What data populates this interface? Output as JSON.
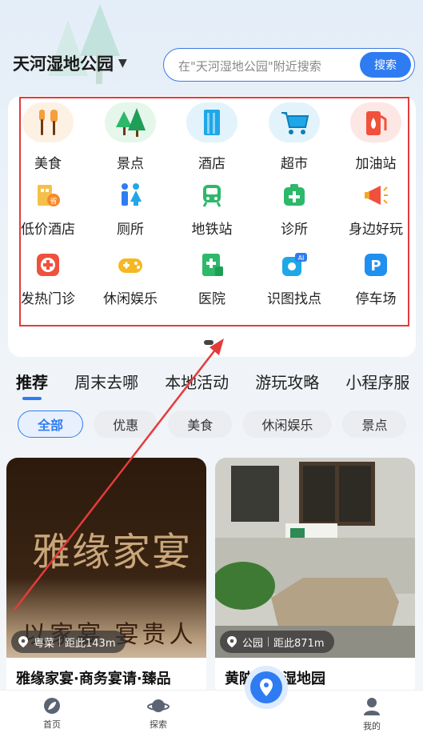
{
  "header": {
    "location": "天河湿地公园",
    "search_placeholder": "在\"天河湿地公园\"附近搜索",
    "search_button": "搜索"
  },
  "categories": [
    {
      "label": "美食",
      "icon": "food-icon",
      "color": "#f59e3b"
    },
    {
      "label": "景点",
      "icon": "trees-icon",
      "color": "#2db86a"
    },
    {
      "label": "酒店",
      "icon": "hotel-icon",
      "color": "#1fa7e8"
    },
    {
      "label": "超市",
      "icon": "cart-icon",
      "color": "#1fa7e8"
    },
    {
      "label": "加油站",
      "icon": "gas-station-icon",
      "color": "#f0503c"
    },
    {
      "label": "低价酒店",
      "icon": "budget-hotel-icon",
      "color": "#f5a623"
    },
    {
      "label": "厕所",
      "icon": "toilet-icon",
      "color": "#2f7cf2"
    },
    {
      "label": "地铁站",
      "icon": "subway-icon",
      "color": "#2db86a"
    },
    {
      "label": "诊所",
      "icon": "clinic-icon",
      "color": "#2db86a"
    },
    {
      "label": "身边好玩",
      "icon": "megaphone-icon",
      "color": "#f5a623"
    },
    {
      "label": "发热门诊",
      "icon": "fever-clinic-icon",
      "color": "#f0503c"
    },
    {
      "label": "休闲娱乐",
      "icon": "gamepad-icon",
      "color": "#f5b823"
    },
    {
      "label": "医院",
      "icon": "hospital-icon",
      "color": "#2db86a"
    },
    {
      "label": "识图找点",
      "icon": "ai-image-search-icon",
      "color": "#1fa7e8"
    },
    {
      "label": "停车场",
      "icon": "parking-icon",
      "color": "#1f8ff0"
    }
  ],
  "tabs": [
    "推荐",
    "周末去哪",
    "本地活动",
    "游玩攻略",
    "小程序服"
  ],
  "chips": [
    "全部",
    "优惠",
    "美食",
    "休闲娱乐",
    "景点"
  ],
  "cards": [
    {
      "image_text": "雅缘家宴",
      "image_slogan": "以家宴 宴贵人",
      "category": "粤菜",
      "distance": "距此143m",
      "title": "雅缘家宴·商务宴请·臻品"
    },
    {
      "category": "公园",
      "distance": "距此871m",
      "title": "黄陂生态湿地园"
    }
  ],
  "bottom_nav": [
    {
      "label": "首页",
      "icon": "home-leaf-icon"
    },
    {
      "label": "探索",
      "icon": "planet-icon"
    },
    {
      "label": "",
      "icon": "location-pin-icon"
    },
    {
      "label": "我的",
      "icon": "user-icon"
    }
  ],
  "colors": {
    "accent": "#2f7cf2",
    "highlight": "#e53b3b"
  }
}
